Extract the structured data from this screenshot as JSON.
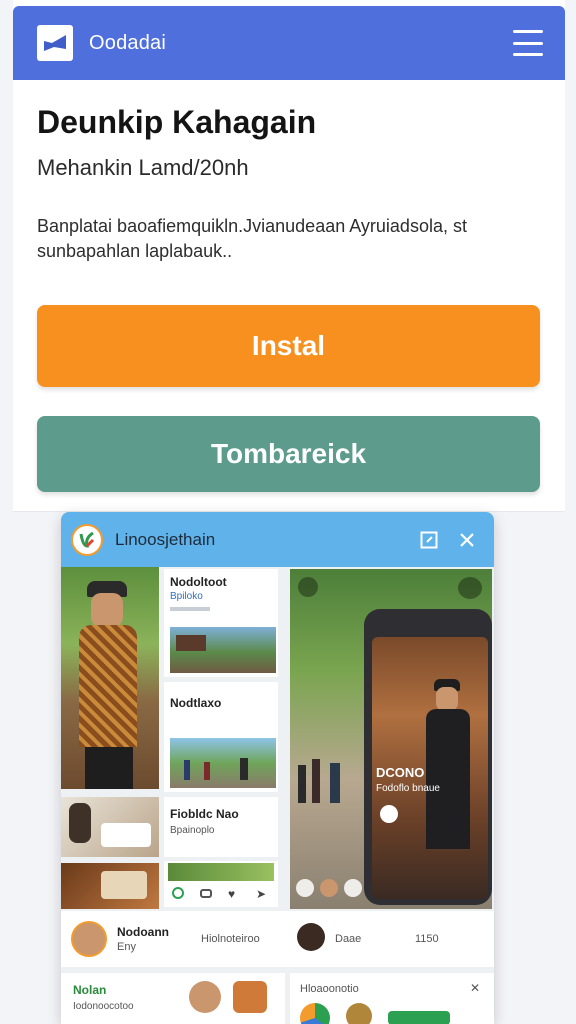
{
  "header": {
    "brand": "Oodadai",
    "logo_icon": "flag-icon",
    "menu_icon": "hamburger-icon"
  },
  "main": {
    "title": "Deunkip Kahagain",
    "subtitle": "Mehankin Lamd/20nh",
    "description": "Banplatai baoafiemquikln.Jvianudeaan Ayruiadsola, st sunbapahlan laplabauk..",
    "install_label": "Instal",
    "second_label": "Tombareick"
  },
  "popup": {
    "title": "Linoosjethain",
    "list": [
      {
        "title": "Nodoltoot",
        "sub": "Bpiloko"
      },
      {
        "title": "Nodtlaxo",
        "sub": ""
      },
      {
        "title": "Fiobldc Nao",
        "sub": "Bpainoplo"
      }
    ],
    "phone_text_1": "DCONO",
    "phone_text_2": "Fodoflo bnaue",
    "card1": {
      "name": "Nodoann",
      "sub": "Eny",
      "meta": "Hiolnoteiroo",
      "name2": "Daae",
      "meta2": "1150"
    },
    "card2": {
      "name": "Nolan",
      "sub": "Iodonoocotoo",
      "title2": "Hloaoonotio"
    }
  },
  "colors": {
    "header": "#4f6fdd",
    "install": "#f7901e",
    "secondary": "#5d9c8c",
    "popup_header": "#5fb3ea"
  }
}
